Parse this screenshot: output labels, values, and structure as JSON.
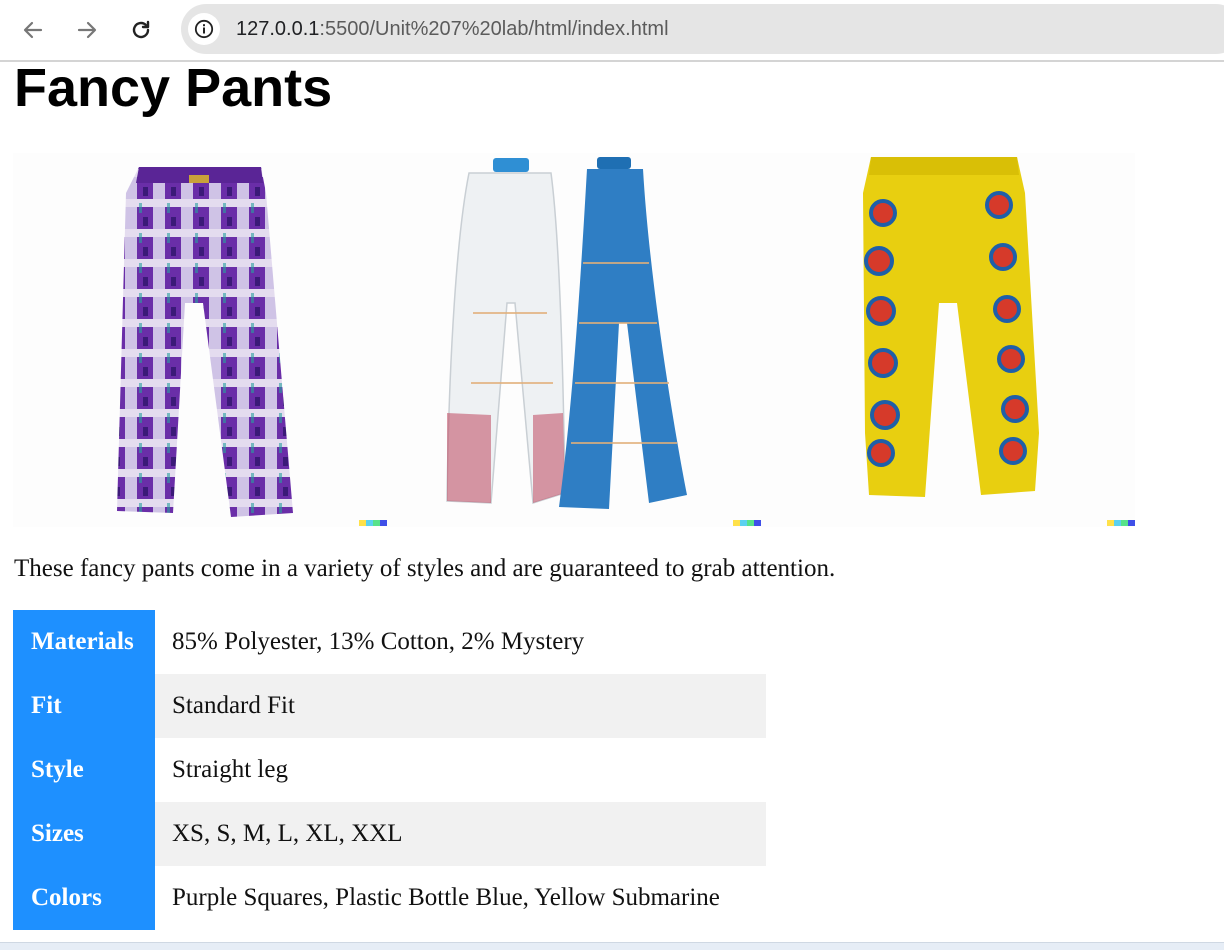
{
  "browser": {
    "url_host": "127.0.0.1",
    "url_rest": ":5500/Unit%207%20lab/html/index.html",
    "icons": [
      "back-arrow-icon",
      "forward-arrow-icon",
      "reload-icon",
      "site-info-icon"
    ]
  },
  "page": {
    "title": "Fancy Pants",
    "description": "These fancy pants come in a variety of styles and are guaranteed to grab attention."
  },
  "gallery": {
    "colors": {
      "purple": "#6a2ea8",
      "plastic": "#e8ecef",
      "denim": "#2f7ec4",
      "yellow": "#e8cf10"
    }
  },
  "specs": {
    "header_color": "#1e90ff",
    "rows": [
      {
        "label": "Materials",
        "value": "85% Polyester, 13% Cotton, 2% Mystery"
      },
      {
        "label": "Fit",
        "value": "Standard Fit"
      },
      {
        "label": "Style",
        "value": "Straight leg"
      },
      {
        "label": "Sizes",
        "value": "XS, S, M, L, XL, XXL"
      },
      {
        "label": "Colors",
        "value": "Purple Squares, Plastic Bottle Blue, Yellow Submarine"
      }
    ]
  }
}
